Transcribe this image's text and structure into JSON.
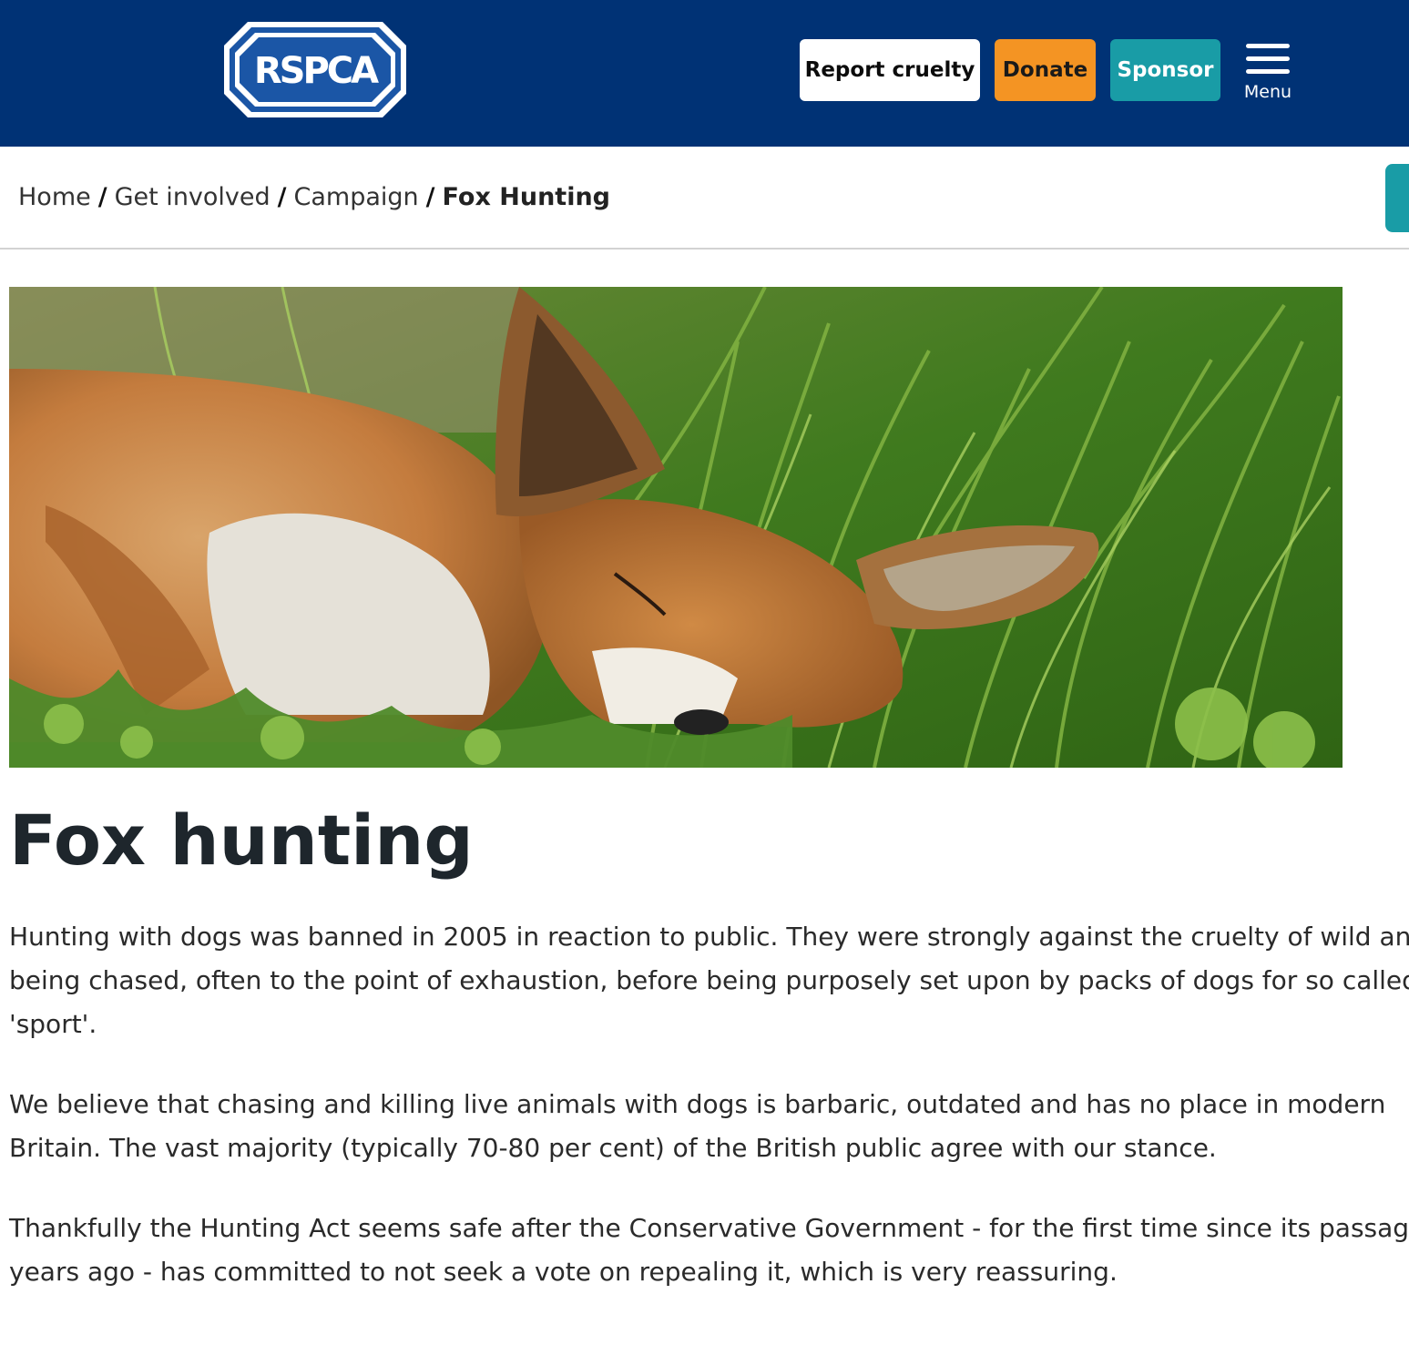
{
  "header": {
    "logo_text": "RSPCA",
    "buttons": {
      "report": "Report cruelty",
      "donate": "Donate",
      "sponsor": "Sponsor"
    },
    "menu_label": "Menu",
    "colors": {
      "background": "#003275",
      "donate": "#f49423",
      "sponsor": "#199ca6"
    }
  },
  "breadcrumb": {
    "items": [
      "Home",
      "Get involved",
      "Campaign"
    ],
    "current": "Fox Hunting",
    "separator": "/"
  },
  "hero": {
    "icon": "sleeping-fox-photo"
  },
  "article": {
    "title": "Fox hunting",
    "paragraphs": [
      [
        "Hunting with dogs was banned in 2005 in reaction to public. They were strongly against the cruelty of wild anim",
        "being chased, often to the point of exhaustion, before being purposely set upon by packs of dogs for so called",
        "'sport'."
      ],
      [
        "We believe that chasing and killing live animals with dogs is barbaric, outdated and has no place in modern",
        "Britain. The vast majority (typically 70-80 per cent) of the British public agree with our stance."
      ],
      [
        "Thankfully the Hunting Act seems safe after the Conservative Government - for the first time since its passage",
        "years ago - has committed to not seek a vote on repealing it, which is very reassuring."
      ]
    ]
  }
}
